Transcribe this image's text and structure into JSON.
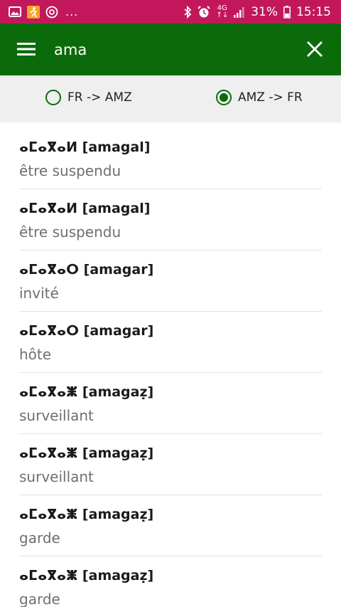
{
  "status_bar": {
    "more_indicator": "...",
    "network_top": "4G",
    "network_bottom": "↑↓",
    "battery_percent": "31%",
    "time": "15:15"
  },
  "app_bar": {
    "search_value": "ama",
    "icons": {
      "menu": "hamburger-menu-icon",
      "close": "close-icon"
    }
  },
  "direction": {
    "options": [
      {
        "label": "FR -> AMZ",
        "selected": false
      },
      {
        "label": "AMZ -> FR",
        "selected": true
      }
    ],
    "accent_color": "#0b6b0b"
  },
  "results": [
    {
      "term": "ⴰⵎⴰⴳⴰⵍ [amagal]",
      "translation": "être suspendu"
    },
    {
      "term": "ⴰⵎⴰⴳⴰⵍ [amagal]",
      "translation": "être suspendu"
    },
    {
      "term": "ⴰⵎⴰⴳⴰⵔ [amagar]",
      "translation": "invité"
    },
    {
      "term": "ⴰⵎⴰⴳⴰⵔ [amagar]",
      "translation": "hôte"
    },
    {
      "term": "ⴰⵎⴰⴳⴰⵥ [amagaẓ]",
      "translation": "surveillant"
    },
    {
      "term": "ⴰⵎⴰⴳⴰⵥ [amagaẓ]",
      "translation": "surveillant"
    },
    {
      "term": "ⴰⵎⴰⴳⴰⵥ [amagaẓ]",
      "translation": "garde"
    },
    {
      "term": "ⴰⵎⴰⴳⴰⵥ [amagaẓ]",
      "translation": "garde"
    }
  ],
  "colors": {
    "status_bar": "#c2185b",
    "app_bar": "#0b6b0b",
    "selector_background": "#efefef"
  }
}
